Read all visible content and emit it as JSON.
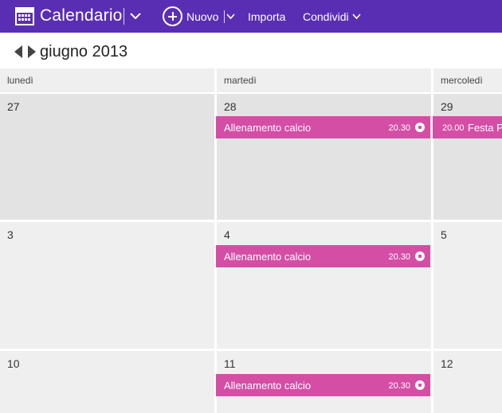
{
  "app": {
    "title": "Calendario"
  },
  "toolbar": {
    "new_label": "Nuovo",
    "import_label": "Importa",
    "share_label": "Condividi"
  },
  "nav": {
    "month_label": "giugno 2013"
  },
  "weekdays": [
    "lunedì",
    "martedì",
    "mercoledì"
  ],
  "weeks": [
    {
      "days": [
        {
          "num": "27"
        },
        {
          "num": "28",
          "event": {
            "title": "Allenamento calcio",
            "time": "20.30"
          }
        },
        {
          "num": "29",
          "event": {
            "title": "Festa P",
            "time": "20.00"
          }
        }
      ]
    },
    {
      "days": [
        {
          "num": "3"
        },
        {
          "num": "4",
          "event": {
            "title": "Allenamento calcio",
            "time": "20.30"
          }
        },
        {
          "num": "5"
        }
      ]
    },
    {
      "days": [
        {
          "num": "10"
        },
        {
          "num": "11",
          "event": {
            "title": "Allenamento calcio",
            "time": "20.30"
          }
        },
        {
          "num": "12"
        }
      ]
    }
  ],
  "colors": {
    "topbar": "#5a2eb3",
    "event": "#d44ea6",
    "cell": "#efefef",
    "cell_past": "#e3e3e3"
  },
  "icons": {
    "app": "calendar-icon",
    "new": "plus-circle-icon",
    "event": "soccer-ball-icon"
  }
}
